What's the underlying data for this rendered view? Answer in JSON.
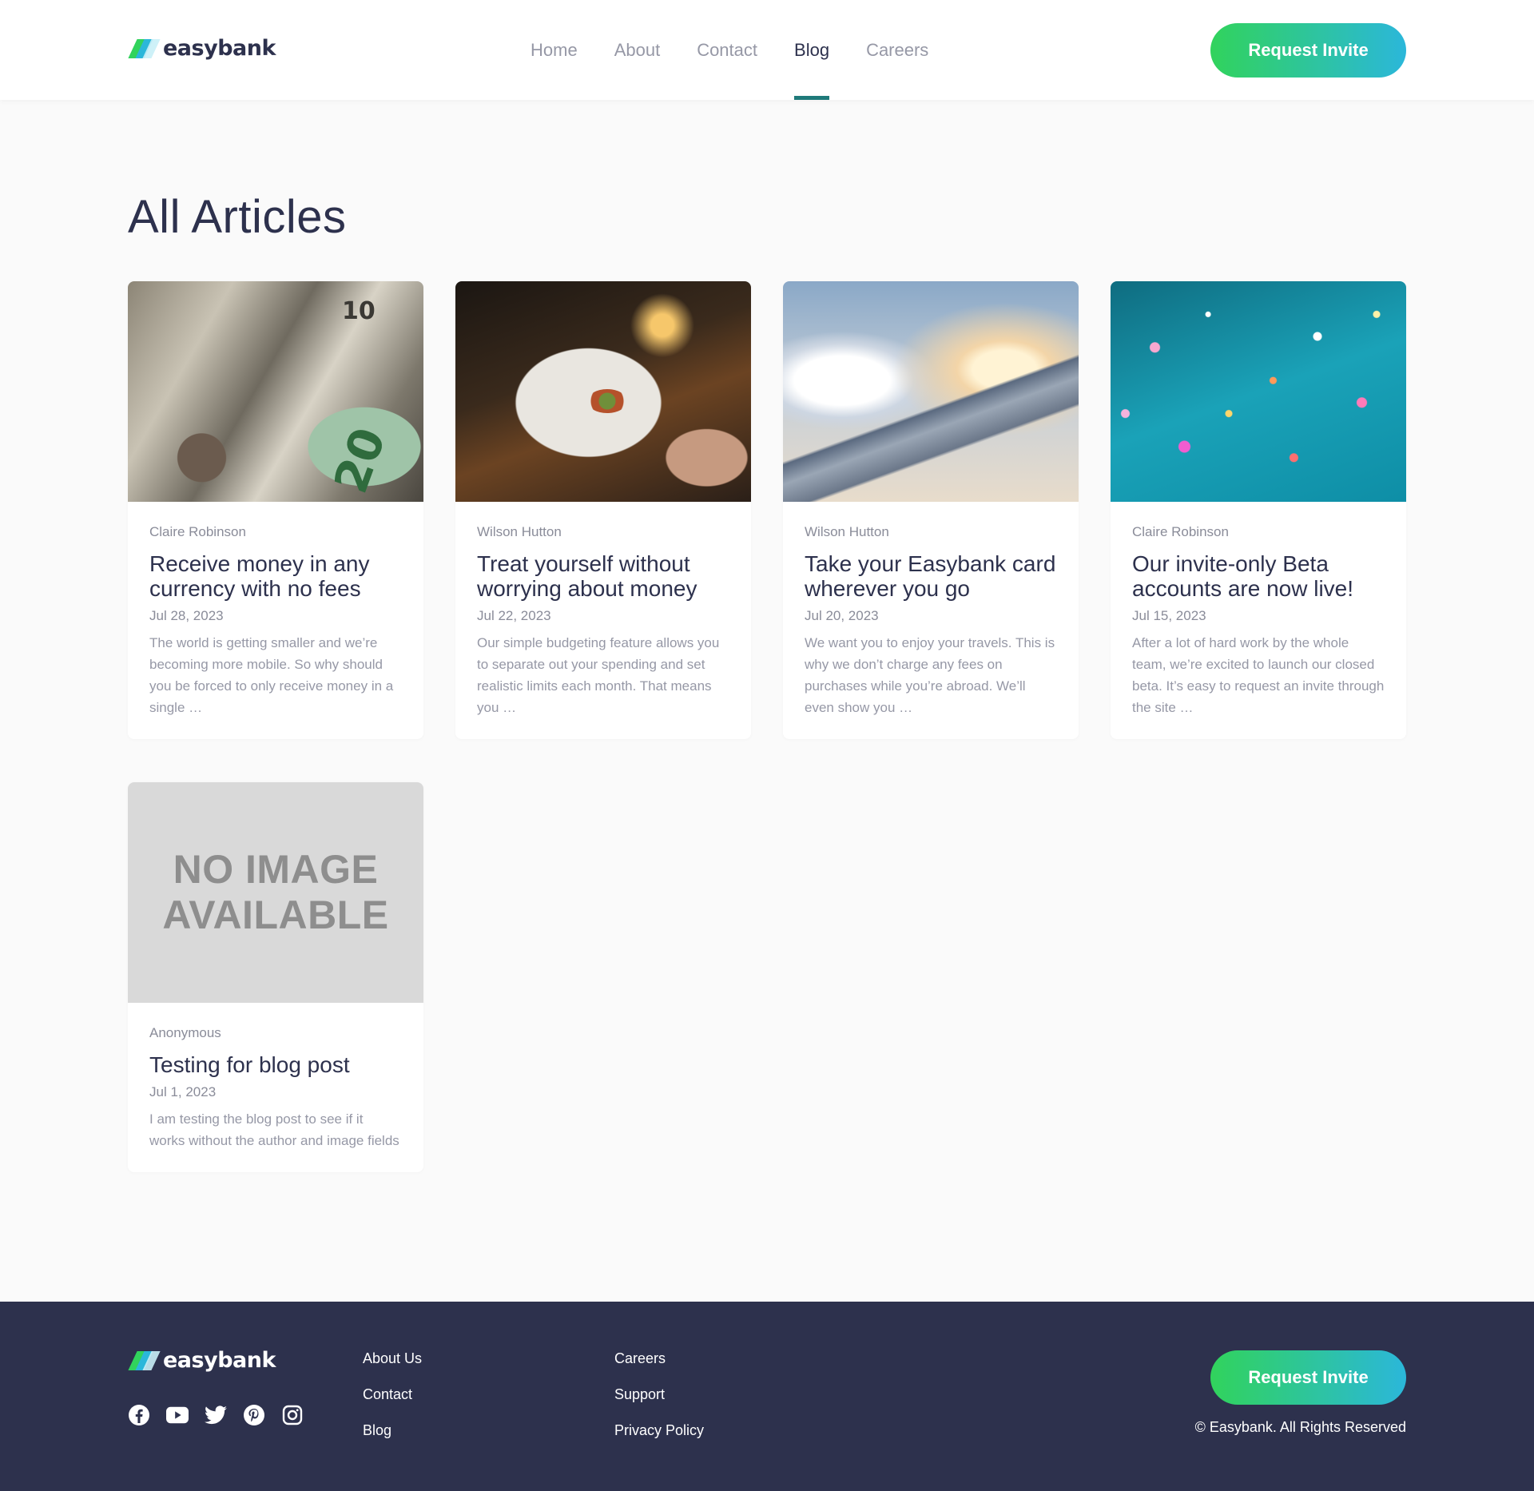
{
  "brand": {
    "name": "easybank"
  },
  "nav": {
    "items": [
      {
        "label": "Home",
        "active": false
      },
      {
        "label": "About",
        "active": false
      },
      {
        "label": "Contact",
        "active": false
      },
      {
        "label": "Blog",
        "active": true
      },
      {
        "label": "Careers",
        "active": false
      }
    ],
    "cta": "Request Invite"
  },
  "main": {
    "title": "All Articles",
    "articles": [
      {
        "author": "Claire Robinson",
        "title": "Receive money in any currency with no fees",
        "date": "Jul 28, 2023",
        "excerpt": "The world is getting smaller and we’re becoming more mobile. So why should you be forced to only receive money in a single …",
        "image": "money-photo",
        "image_text": [
          "10",
          "20"
        ]
      },
      {
        "author": "Wilson Hutton",
        "title": "Treat yourself without worrying about money",
        "date": "Jul 22, 2023",
        "excerpt": "Our simple budgeting feature allows you to separate out your spending and set realistic limits each month. That means you …",
        "image": "restaurant-photo"
      },
      {
        "author": "Wilson Hutton",
        "title": "Take your Easybank card wherever you go",
        "date": "Jul 20, 2023",
        "excerpt": "We want you to enjoy your travels. This is why we don’t charge any fees on purchases while you’re abroad. We’ll even show you …",
        "image": "plane-wing-photo"
      },
      {
        "author": "Claire Robinson",
        "title": "Our invite-only Beta accounts are now live!",
        "date": "Jul 15, 2023",
        "excerpt": "After a lot of hard work by the whole team, we’re excited to launch our closed beta. It’s easy to request an invite through the site …",
        "image": "confetti-photo"
      },
      {
        "author": "Anonymous",
        "title": "Testing for blog post",
        "date": "Jul 1, 2023",
        "excerpt": "I am testing the blog post to see if it works without the author and image fields",
        "image": "no-image-placeholder",
        "image_text": [
          "NO IMAGE",
          "AVAILABLE"
        ]
      }
    ]
  },
  "footer": {
    "socials": [
      "facebook-icon",
      "youtube-icon",
      "twitter-icon",
      "pinterest-icon",
      "instagram-icon"
    ],
    "links_col1": [
      "About Us",
      "Contact",
      "Blog"
    ],
    "links_col2": [
      "Careers",
      "Support",
      "Privacy Policy"
    ],
    "cta": "Request Invite",
    "copyright": "© Easybank. All Rights Reserved"
  },
  "colors": {
    "primary_dark": "#2d314d",
    "gradient_start": "#31d35c",
    "gradient_end": "#2bb7da",
    "nav_active_underline": "#1f7a7a",
    "background": "#fafafa"
  }
}
